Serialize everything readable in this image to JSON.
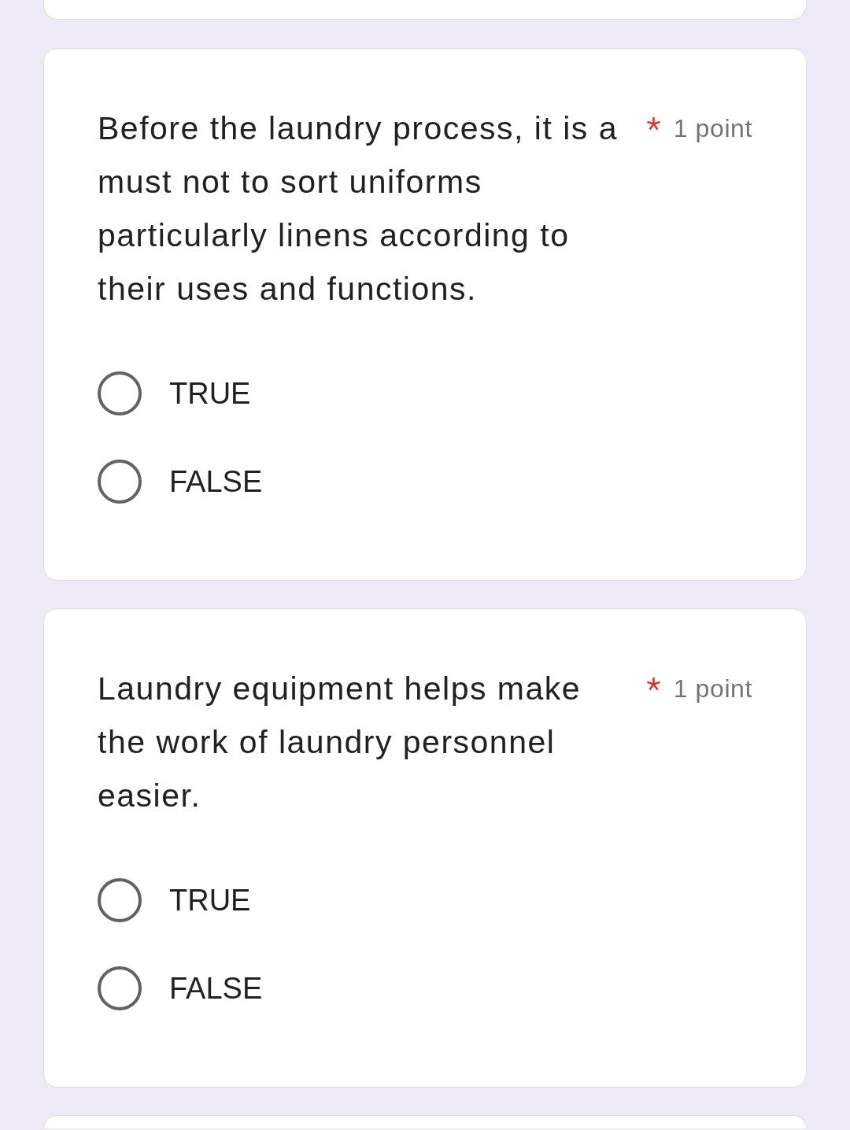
{
  "questions": [
    {
      "title": "Before the laundry process, it is a must not to sort uniforms particularly linens according to their uses and functions.",
      "required": true,
      "points": "1 point",
      "options": [
        {
          "label": "TRUE",
          "selected": false
        },
        {
          "label": "FALSE",
          "selected": false
        }
      ]
    },
    {
      "title": "Laundry equipment helps make the work of laundry personnel easier.",
      "required": true,
      "points": "1 point",
      "options": [
        {
          "label": "TRUE",
          "selected": false
        },
        {
          "label": "FALSE",
          "selected": false
        }
      ]
    }
  ]
}
